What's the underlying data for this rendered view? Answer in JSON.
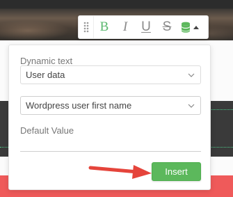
{
  "toolbar": {
    "bold_label": "B",
    "italic_label": "I",
    "underline_label": "U",
    "strike_label": "S",
    "buttons": [
      {
        "name": "drag-handle",
        "icon": "grip-dots-icon"
      },
      {
        "name": "bold",
        "icon": "bold-icon"
      },
      {
        "name": "italic",
        "icon": "italic-icon"
      },
      {
        "name": "underline",
        "icon": "underline-icon"
      },
      {
        "name": "strikethrough",
        "icon": "strikethrough-icon"
      },
      {
        "name": "dynamic-data",
        "icon": "database-icon"
      }
    ]
  },
  "panel": {
    "dynamic_text_label": "Dynamic text",
    "source_select_value": "User data",
    "field_select_value": "Wordpress user first name",
    "default_value_label": "Default Value",
    "default_value": "",
    "insert_label": "Insert"
  },
  "colors": {
    "accent_green": "#5cb85c",
    "icon_green": "#5bb86f",
    "annotation_red": "#e5443b",
    "banner_red": "#ef5a5a"
  }
}
